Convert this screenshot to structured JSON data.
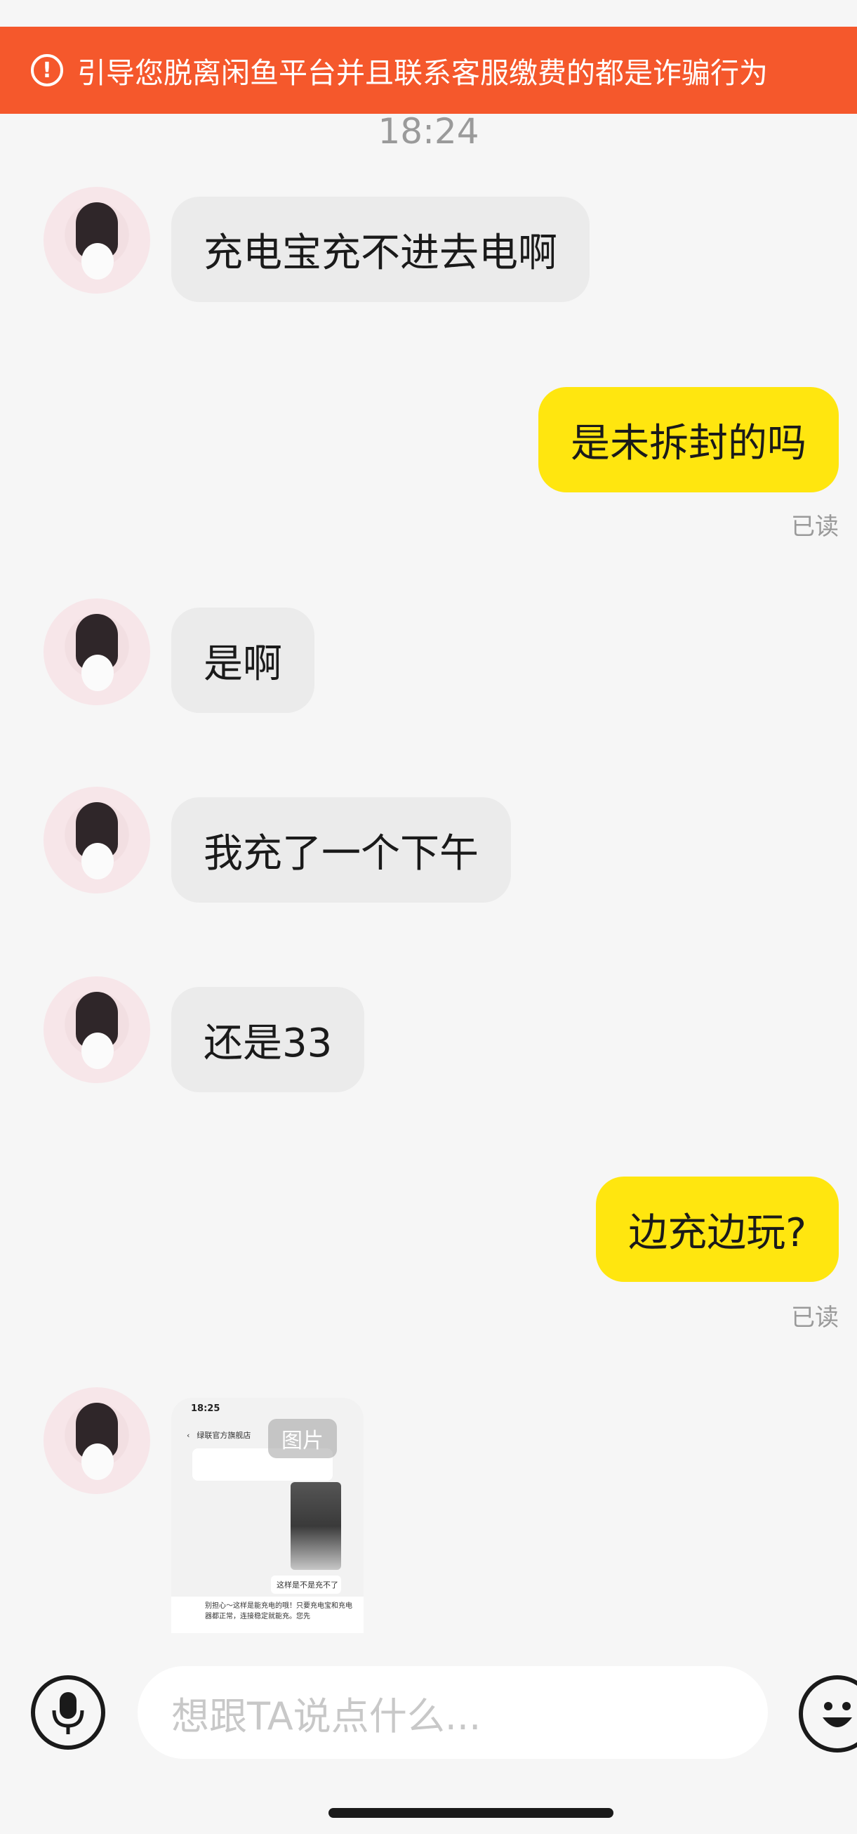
{
  "warning_banner": {
    "text": "引导您脱离闲鱼平台并且联系客服缴费的都是诈骗行为",
    "icon": "exclamation-circle-icon",
    "color": "#f5582c"
  },
  "chat": {
    "timestamp": "18:24",
    "messages": [
      {
        "from": "other",
        "text": "充电宝充不进去电啊"
      },
      {
        "from": "me",
        "text": "是未拆封的吗",
        "status": "已读"
      },
      {
        "from": "other",
        "text": "是啊"
      },
      {
        "from": "other",
        "text": "我充了一个下午"
      },
      {
        "from": "other",
        "text": "还是33"
      },
      {
        "from": "me",
        "text": "边充边玩?",
        "status": "已读"
      },
      {
        "from": "other",
        "type": "image",
        "badge": "图片",
        "preview": {
          "time": "18:25",
          "store": "绿联官方旗舰店",
          "question": "这样是不是充不了",
          "reply": "别担心～这样是能充电的哦！只要充电宝和充电器都正常，连接稳定就能充。您先"
        }
      }
    ]
  },
  "input_bar": {
    "placeholder": "想跟TA说点什么...",
    "mic_icon": "microphone-icon",
    "emoji_icon": "smile-emoji-icon"
  },
  "colors": {
    "outgoing_bubble": "#ffe60f",
    "incoming_bubble": "#ebebeb",
    "background": "#f6f6f6"
  }
}
